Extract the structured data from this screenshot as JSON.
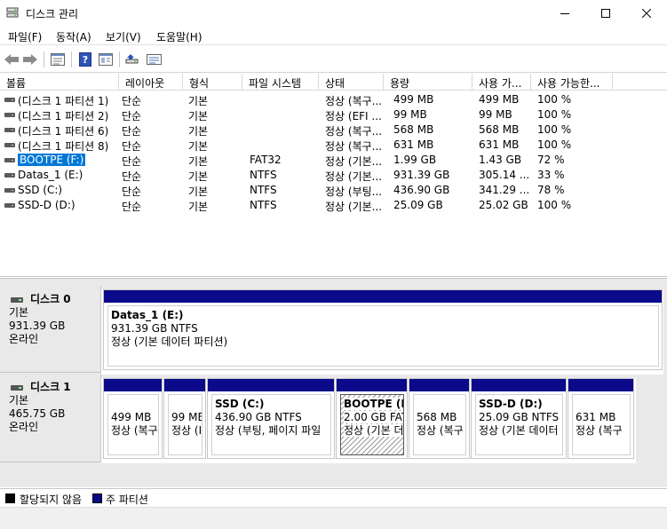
{
  "window": {
    "title": "디스크 관리"
  },
  "menu": [
    "파일(F)",
    "동작(A)",
    "보기(V)",
    "도움말(H)"
  ],
  "toolbar": {
    "icons": [
      "back-icon",
      "forward-icon",
      "properties-icon",
      "help-icon",
      "list-view-icon",
      "disk-icon",
      "settings-icon"
    ]
  },
  "columns": [
    "볼륨",
    "레이아웃",
    "형식",
    "파일 시스템",
    "상태",
    "용량",
    "사용 가...",
    "사용 가능한..."
  ],
  "volumes": [
    {
      "name": "(디스크 1 파티션 1)",
      "layout": "단순",
      "type": "기본",
      "fs": "",
      "status": "정상 (복구...",
      "capacity": "499 MB",
      "free": "499 MB",
      "pct": "100 %"
    },
    {
      "name": "(디스크 1 파티션 2)",
      "layout": "단순",
      "type": "기본",
      "fs": "",
      "status": "정상 (EFI ...",
      "capacity": "99 MB",
      "free": "99 MB",
      "pct": "100 %"
    },
    {
      "name": "(디스크 1 파티션 6)",
      "layout": "단순",
      "type": "기본",
      "fs": "",
      "status": "정상 (복구...",
      "capacity": "568 MB",
      "free": "568 MB",
      "pct": "100 %"
    },
    {
      "name": "(디스크 1 파티션 8)",
      "layout": "단순",
      "type": "기본",
      "fs": "",
      "status": "정상 (복구...",
      "capacity": "631 MB",
      "free": "631 MB",
      "pct": "100 %"
    },
    {
      "name": "BOOTPE (F:)",
      "layout": "단순",
      "type": "기본",
      "fs": "FAT32",
      "status": "정상 (기본...",
      "capacity": "1.99 GB",
      "free": "1.43 GB",
      "pct": "72 %"
    },
    {
      "name": "Datas_1 (E:)",
      "layout": "단순",
      "type": "기본",
      "fs": "NTFS",
      "status": "정상 (기본...",
      "capacity": "931.39 GB",
      "free": "305.14 ...",
      "pct": "33 %"
    },
    {
      "name": "SSD (C:)",
      "layout": "단순",
      "type": "기본",
      "fs": "NTFS",
      "status": "정상 (부팅...",
      "capacity": "436.90 GB",
      "free": "341.29 ...",
      "pct": "78 %"
    },
    {
      "name": "SSD-D (D:)",
      "layout": "단순",
      "type": "기본",
      "fs": "NTFS",
      "status": "정상 (기본...",
      "capacity": "25.09 GB",
      "free": "25.02 GB",
      "pct": "100 %"
    }
  ],
  "disks": [
    {
      "name": "디스크 0",
      "type": "기본",
      "size": "931.39 GB",
      "state": "온라인",
      "partitions": [
        {
          "title": "Datas_1  (E:)",
          "line1": "931.39 GB NTFS",
          "line2": "정상 (기본 데이터 파티션)"
        }
      ]
    },
    {
      "name": "디스크 1",
      "type": "기본",
      "size": "465.75 GB",
      "state": "온라인",
      "partitions": [
        {
          "title": "",
          "line1": "499 MB",
          "line2": "정상 (복구"
        },
        {
          "title": "",
          "line1": "99 ME",
          "line2": "정상 (I"
        },
        {
          "title": "SSD  (C:)",
          "line1": "436.90 GB NTFS",
          "line2": "정상 (부팅, 페이지 파일"
        },
        {
          "title": "BOOTPE  (F:",
          "line1": "2.00 GB FAT",
          "line2": "정상 (기본 더"
        },
        {
          "title": "",
          "line1": "568 MB",
          "line2": "정상 (복구"
        },
        {
          "title": "SSD-D  (D:)",
          "line1": "25.09 GB NTFS",
          "line2": "정상 (기본 데이터"
        },
        {
          "title": "",
          "line1": "631 MB",
          "line2": "정상 (복구"
        }
      ]
    }
  ],
  "legend": [
    {
      "label": "할당되지 않음",
      "color": "#000000"
    },
    {
      "label": "주 파티션",
      "color": "#0a0a8a"
    }
  ]
}
